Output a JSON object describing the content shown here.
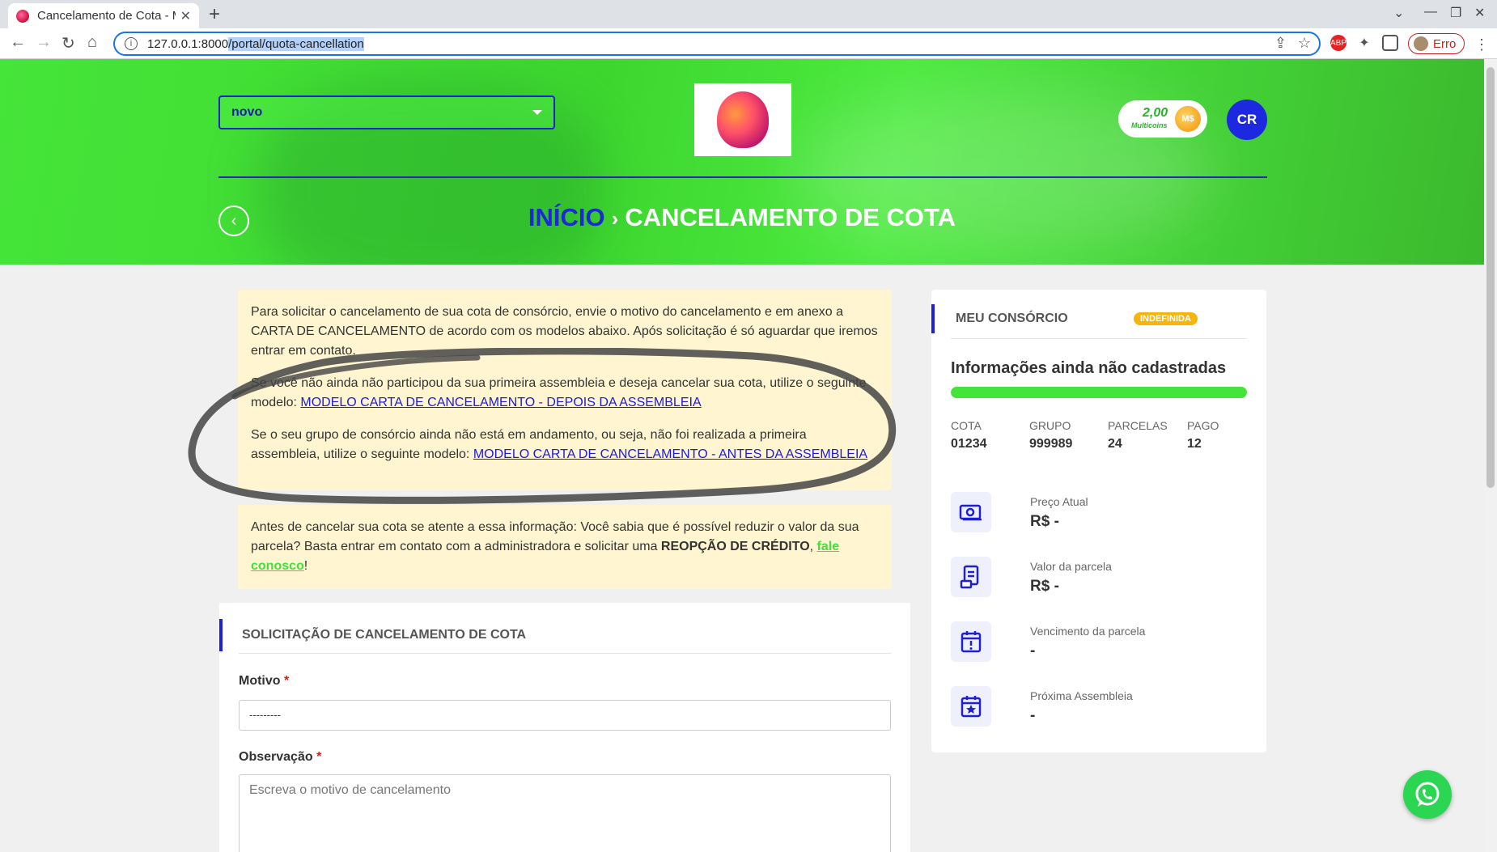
{
  "browser": {
    "tab_title": "Cancelamento de Cota - M",
    "url_host": "127.0.0.1:8000",
    "url_path": "/portal/quota-cancellation",
    "profile_label": "Erro",
    "abp_label": "ABP"
  },
  "header": {
    "select_value": "novo",
    "coins_value": "2,00",
    "coins_label": "Multicoins",
    "coin_symbol": "M$",
    "avatar_initials": "CR",
    "breadcrumb_home": "INÍCIO",
    "breadcrumb_sep": "›",
    "breadcrumb_current": "CANCELAMENTO DE COTA"
  },
  "notice1": {
    "p1": "Para solicitar o cancelamento de sua cota de consórcio, envie o motivo do cancelamento e em anexo a CARTA DE CANCELAMENTO de acordo com os modelos abaixo. Após solicitação é só aguardar que iremos entrar em contato.",
    "p2_text": "Se você não ainda não participou da sua primeira assembleia e deseja cancelar sua cota, utilize o seguinte modelo: ",
    "p2_link": "MODELO CARTA DE CANCELAMENTO - DEPOIS DA ASSEMBLEIA",
    "p3_text": "Se o seu grupo de consórcio ainda não está em andamento, ou seja, não foi realizada a primeira assembleia, utilize o seguinte modelo: ",
    "p3_link": "MODELO CARTA DE CANCELAMENTO - ANTES DA ASSEMBLEIA"
  },
  "notice2": {
    "text": "Antes de cancelar sua cota se atente a essa informação: Você sabia que é possível reduzir o valor da sua parcela? Basta entrar em contato com a administradora e solicitar uma ",
    "bold": "REOPÇÃO DE CRÉDITO",
    "comma": ", ",
    "link": "fale conosco",
    "end": "!"
  },
  "form": {
    "title": "SOLICITAÇÃO DE CANCELAMENTO DE COTA",
    "motivo_label": "Motivo",
    "required_mark": "*",
    "motivo_value": "---------",
    "obs_label": "Observação",
    "obs_placeholder": "Escreva o motivo de cancelamento"
  },
  "sidebar": {
    "title": "MEU CONSÓRCIO",
    "badge": "INDEFINIDA",
    "heading": "Informações ainda não cadastradas",
    "progress": 1.0,
    "stats": [
      {
        "label": "COTA",
        "value": "01234"
      },
      {
        "label": "GRUPO",
        "value": "999989"
      },
      {
        "label": "PARCELAS",
        "value": "24"
      },
      {
        "label": "PAGO",
        "value": "12"
      }
    ],
    "info": [
      {
        "icon": "money-icon",
        "label": "Preço Atual",
        "value": "R$ -"
      },
      {
        "icon": "invoice-icon",
        "label": "Valor da parcela",
        "value": "R$ -"
      },
      {
        "icon": "calendar-alert-icon",
        "label": "Vencimento da parcela",
        "value": "-"
      },
      {
        "icon": "calendar-star-icon",
        "label": "Próxima Assembleia",
        "value": "-"
      }
    ]
  },
  "colors": {
    "brand_green": "#46e53a",
    "brand_blue": "#1c29e0",
    "notice_bg": "#fff5d1",
    "badge": "#f5b50a"
  }
}
